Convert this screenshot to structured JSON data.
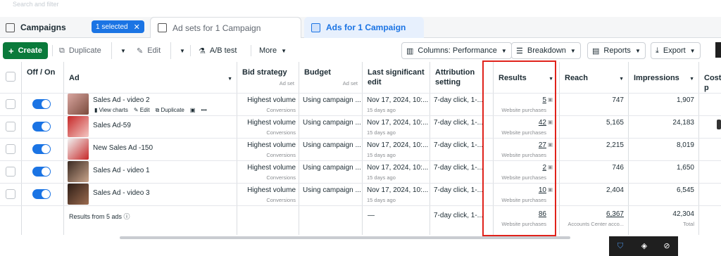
{
  "search": {
    "placeholder": "Search and filter"
  },
  "tabs": {
    "campaigns": "Campaigns",
    "selected_badge": "1 selected",
    "adsets": "Ad sets for 1 Campaign",
    "ads": "Ads for 1 Campaign"
  },
  "toolbar": {
    "create": "Create",
    "duplicate": "Duplicate",
    "edit": "Edit",
    "ab_test": "A/B test",
    "more": "More",
    "columns": "Columns: Performance",
    "breakdown": "Breakdown",
    "reports": "Reports",
    "export": "Export"
  },
  "columns": {
    "off_on": "Off / On",
    "ad": "Ad",
    "bid_strategy": "Bid strategy",
    "bid_strategy_sub": "Ad set",
    "budget": "Budget",
    "budget_sub": "Ad set",
    "last_edit": "Last significant edit",
    "attribution": "Attribution setting",
    "results": "Results",
    "reach": "Reach",
    "impressions": "Impressions",
    "cost": "Cost p"
  },
  "row_actions": {
    "view_charts": "View charts",
    "edit": "Edit",
    "duplicate": "Duplicate",
    "more": "•••"
  },
  "rows": [
    {
      "name": "Sales Ad - video 2",
      "bid": "Highest volume",
      "bid_sub": "Conversions",
      "budget": "Using campaign ...",
      "edit": "Nov 17, 2024, 10:...",
      "edit_sub": "15 days ago",
      "attribution": "7-day click, 1-...",
      "results": "5",
      "results_sub": "Website purchases",
      "reach": "747",
      "impressions": "1,907"
    },
    {
      "name": "Sales Ad-59",
      "bid": "Highest volume",
      "bid_sub": "Conversions",
      "budget": "Using campaign ...",
      "edit": "Nov 17, 2024, 10:...",
      "edit_sub": "15 days ago",
      "attribution": "7-day click, 1-...",
      "results": "42",
      "results_sub": "Website purchases",
      "reach": "5,165",
      "impressions": "24,183"
    },
    {
      "name": "New Sales Ad -150",
      "bid": "Highest volume",
      "bid_sub": "Conversions",
      "budget": "Using campaign ...",
      "edit": "Nov 17, 2024, 10:...",
      "edit_sub": "15 days ago",
      "attribution": "7-day click, 1-...",
      "results": "27",
      "results_sub": "Website purchases",
      "reach": "2,215",
      "impressions": "8,019"
    },
    {
      "name": "Sales Ad - video 1",
      "bid": "Highest volume",
      "bid_sub": "Conversions",
      "budget": "Using campaign ...",
      "edit": "Nov 17, 2024, 10:...",
      "edit_sub": "15 days ago",
      "attribution": "7-day click, 1-...",
      "results": "2",
      "results_sub": "Website purchases",
      "reach": "746",
      "impressions": "1,650"
    },
    {
      "name": "Sales Ad - video 3",
      "bid": "Highest volume",
      "bid_sub": "Conversions",
      "budget": "Using campaign ...",
      "edit": "Nov 17, 2024, 10:...",
      "edit_sub": "15 days ago",
      "attribution": "7-day click, 1-...",
      "results": "10",
      "results_sub": "Website purchases",
      "reach": "2,404",
      "impressions": "6,545"
    }
  ],
  "summary": {
    "label": "Results from 5 ads",
    "edit": "—",
    "attribution": "7-day click, 1-...",
    "results": "86",
    "results_sub": "Website purchases",
    "reach": "6,367",
    "reach_sub": "Accounts Center acco...",
    "impressions": "42,304",
    "impressions_sub": "Total"
  },
  "colors": {
    "accent": "#1b74e4",
    "create": "#0a7a3b",
    "highlight": "#e0221b"
  }
}
